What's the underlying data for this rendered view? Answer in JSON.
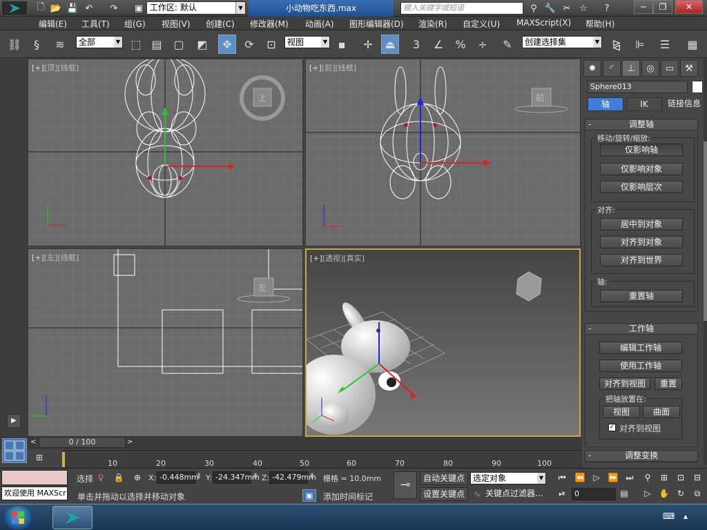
{
  "titlebar": {
    "workspace_label": "工作区: 默认",
    "doc_title": "小动物吃东西.max",
    "search_placeholder": "键入关键字或短语"
  },
  "menu": [
    "编辑(E)",
    "工具(T)",
    "组(G)",
    "视图(V)",
    "创建(C)",
    "修改器(M)",
    "动画(A)",
    "图形编辑器(D)",
    "渲染(R)",
    "自定义(U)",
    "MAXScript(X)",
    "帮助(H)"
  ],
  "toolbar": {
    "filter_select": "全部",
    "ref_coord_select": "视图",
    "named_selection_set": "创建选择集",
    "snap_3": "3",
    "percent_snap": "%"
  },
  "viewports": {
    "top": {
      "label_plus": "[+]",
      "label_view": "[顶]",
      "label_shade": "[线框]",
      "cube_label": "上"
    },
    "front": {
      "label_plus": "[+]",
      "label_view": "[前]",
      "label_shade": "[线框]",
      "cube_label": "前"
    },
    "left": {
      "label_plus": "[+]",
      "label_view": "[左]",
      "label_shade": "[线框]",
      "cube_label": "左"
    },
    "persp": {
      "label_plus": "[+]",
      "label_view": "[透视]",
      "label_shade": "[真实]"
    }
  },
  "panel": {
    "object_name": "Sphere013",
    "tabs": [
      "轴",
      "IK",
      "链接信息"
    ],
    "adjust_pivot": {
      "title": "调整轴",
      "group_move": "移动/旋转/缩放:",
      "btn_affect_pivot": "仅影响轴",
      "btn_affect_object": "仅影响对象",
      "btn_affect_hierarchy": "仅影响层次",
      "group_align": "对齐:",
      "btn_center_to_object": "居中到对象",
      "btn_align_to_object": "对齐到对象",
      "btn_align_to_world": "对齐到世界",
      "group_pivot": "轴:",
      "btn_reset_pivot": "重置轴"
    },
    "working_pivot": {
      "title": "工作轴",
      "btn_edit": "编辑工作轴",
      "btn_use": "使用工作轴",
      "btn_align_view": "对齐到视图",
      "btn_reset": "重置",
      "group_place": "把轴放置在:",
      "btn_view": "视图",
      "btn_surface": "曲面",
      "chk_align_view": "对齐到视图",
      "chk_align_view_checked": true
    },
    "adjust_transform_title": "调整变换"
  },
  "timeline": {
    "slider_text": "0 / 100",
    "ticks": [
      "10",
      "20",
      "30",
      "40",
      "50",
      "60",
      "70",
      "80",
      "90",
      "100"
    ]
  },
  "status": {
    "welcome": "欢迎使用 MAXScr",
    "select_label": "选择",
    "x_label": "X:",
    "x_value": "-0.448mm",
    "y_label": "Y:",
    "y_value": "-24.347mm",
    "z_label": "Z:",
    "z_value": "-42.479mm",
    "grid": "栅格 = 10.0mm",
    "prompt": "单击并拖动以选择并移动对象",
    "add_time_tag": "添加时间标记",
    "auto_key": "自动关键点",
    "set_key": "设置关键点",
    "selected_select": "选定对象",
    "key_filters": "关键点过滤器...",
    "frame_value": "0"
  },
  "colors": {
    "accent": "#3c7ed8",
    "viewport_bg": "#6b6b6b",
    "active_border": "#c8a84a"
  }
}
